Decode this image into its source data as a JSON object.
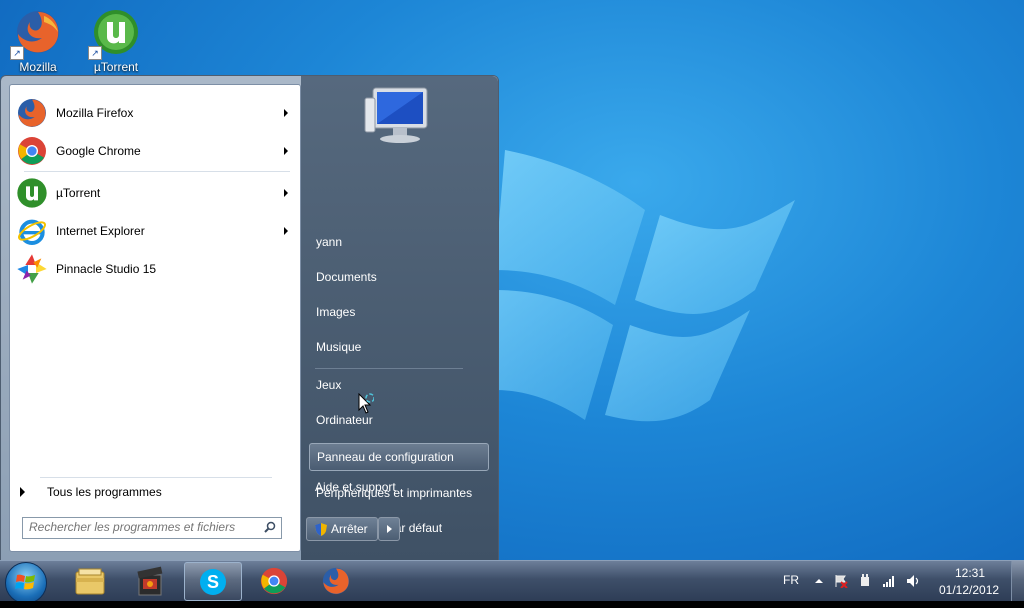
{
  "desktop": {
    "icons": [
      {
        "label": "Mozilla",
        "icon": "firefox-icon"
      },
      {
        "label": "µTorrent",
        "icon": "utorrent-icon"
      }
    ]
  },
  "start_menu": {
    "programs": [
      {
        "label": "Mozilla Firefox",
        "icon": "firefox-icon",
        "has_submenu": true
      },
      {
        "label": "Google Chrome",
        "icon": "chrome-icon",
        "has_submenu": true
      },
      {
        "label": "µTorrent",
        "icon": "utorrent-icon",
        "has_submenu": true
      },
      {
        "label": "Internet Explorer",
        "icon": "internet-explorer-icon",
        "has_submenu": true
      },
      {
        "label": "Pinnacle Studio 15",
        "icon": "pinnacle-studio-icon",
        "has_submenu": false
      }
    ],
    "all_programs_label": "Tous les programmes",
    "search_placeholder": "Rechercher les programmes et fichiers",
    "right_items": [
      {
        "label": "yann"
      },
      {
        "label": "Documents"
      },
      {
        "label": "Images"
      },
      {
        "label": "Musique"
      },
      {
        "label": "Jeux"
      },
      {
        "label": "Ordinateur"
      },
      {
        "label": "Panneau de configuration",
        "highlighted": true
      },
      {
        "label": "Périphériques et imprimantes"
      },
      {
        "label": "Programmes par défaut"
      },
      {
        "label": "Aide et support"
      }
    ],
    "shutdown_label": "Arrêter"
  },
  "taskbar": {
    "pinned": [
      {
        "name": "explorer-icon"
      },
      {
        "name": "media-center-icon"
      },
      {
        "name": "skype-icon",
        "active": true
      },
      {
        "name": "chrome-icon"
      },
      {
        "name": "firefox-icon"
      }
    ],
    "language": "FR",
    "time": "12:31",
    "date": "01/12/2012"
  },
  "colors": {
    "desktop_blue": "#1d86d6",
    "start_menu_right": "#4a5c72",
    "taskbar": "#3e4f69"
  }
}
